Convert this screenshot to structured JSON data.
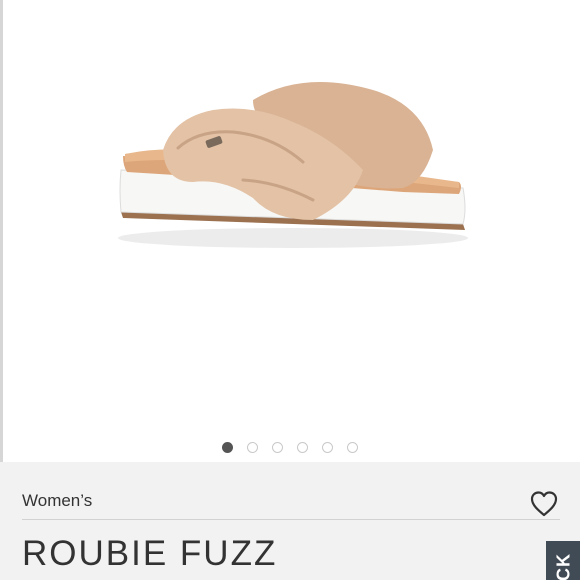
{
  "gallery": {
    "image_description_icon": "fuzzy-slide-sandal-image",
    "slide_count": 6,
    "active_slide": 1
  },
  "product": {
    "category": "Women’s",
    "title": "ROUBIE FUZZ"
  },
  "side_tab": {
    "label": "CK"
  },
  "colors": {
    "info_background": "#f2f2f2",
    "active_dot": "#555555",
    "inactive_dot": "#c9c9c9",
    "text": "#333333",
    "side_tab": "#414b55"
  }
}
